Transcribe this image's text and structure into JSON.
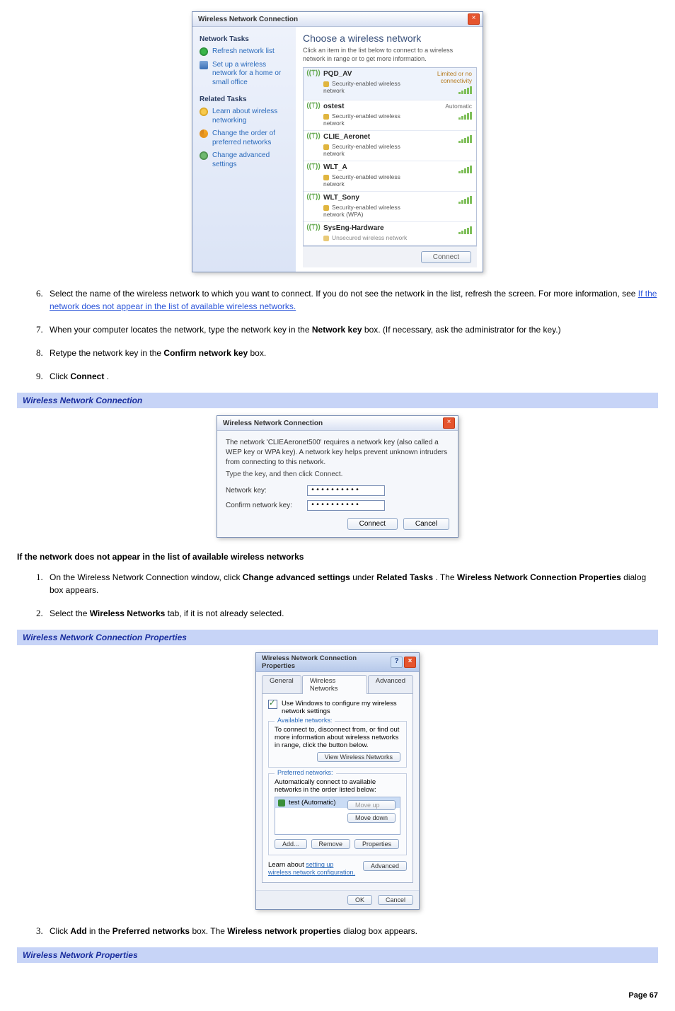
{
  "figure1": {
    "window_title": "Wireless Network Connection",
    "close_icon": "×",
    "sidebar": {
      "tasks_header": "Network Tasks",
      "refresh": "Refresh network list",
      "setup": "Set up a wireless network for a home or small office",
      "related_header": "Related Tasks",
      "learn": "Learn about wireless networking",
      "order": "Change the order of preferred networks",
      "adv": "Change advanced settings"
    },
    "main": {
      "heading": "Choose a wireless network",
      "subtext": "Click an item in the list below to connect to a wireless network in range or to get more information.",
      "signal_glyph": "((⍡))",
      "networks": [
        {
          "name": "PQD_AV",
          "desc": "Security-enabled wireless network",
          "status": "Limited or no connectivity",
          "status_kind": "warn"
        },
        {
          "name": "ostest",
          "desc": "Security-enabled wireless network",
          "status": "Automatic",
          "status_kind": "auto"
        },
        {
          "name": "CLIE_Aeronet",
          "desc": "Security-enabled wireless network",
          "status": "",
          "status_kind": ""
        },
        {
          "name": "WLT_A",
          "desc": "Security-enabled wireless network",
          "status": "",
          "status_kind": ""
        },
        {
          "name": "WLT_Sony",
          "desc": "Security-enabled wireless network (WPA)",
          "status": "",
          "status_kind": ""
        },
        {
          "name": "SysEng-Hardware",
          "desc": "Unsecured wireless network",
          "status": "",
          "status_kind": ""
        }
      ],
      "connect_btn": "Connect"
    }
  },
  "step6": {
    "text_a": "Select the name of the wireless network to which you want to connect. If you do not see the network in the list, refresh the screen. For more information, see ",
    "link": "If the network does not appear in the list of available wireless networks."
  },
  "step7": {
    "text_a": "When your computer locates the network, type the network key in the ",
    "bold_a": "Network key",
    "text_b": " box. (If necessary, ask the administrator for the key.)"
  },
  "step8": {
    "text_a": "Retype the network key in the ",
    "bold_a": "Confirm network key",
    "text_b": " box."
  },
  "step9": {
    "text_a": "Click ",
    "bold_a": "Connect",
    "text_b": "."
  },
  "bar1": "Wireless Network Connection",
  "figure2": {
    "window_title": "Wireless Network Connection",
    "msg": "The network 'CLIEAeronet500' requires a network key (also called a WEP key or WPA key). A network key helps prevent unknown intruders from connecting to this network.",
    "hint": "Type the key, and then click Connect.",
    "label_key": "Network key:",
    "label_confirm": "Confirm network key:",
    "pw_display": "••••••••••",
    "btn_connect": "Connect",
    "btn_cancel": "Cancel",
    "close_icon": "×"
  },
  "subheading": "If the network does not appear in the list of available wireless networks",
  "step_b1": {
    "text_a": "On the Wireless Network Connection window, click ",
    "bold_a": "Change advanced settings",
    "text_b": " under ",
    "bold_b": "Related Tasks",
    "text_c": ". The ",
    "bold_c": "Wireless Network Connection Properties",
    "text_d": " dialog box appears."
  },
  "step_b2": {
    "text_a": "Select the ",
    "bold_a": "Wireless Networks",
    "text_b": " tab, if it is not already selected."
  },
  "bar2": "Wireless Network Connection Properties",
  "figure3": {
    "window_title": "Wireless Network Connection Properties",
    "help_icon": "?",
    "close_icon": "×",
    "tab_general": "General",
    "tab_wireless": "Wireless Networks",
    "tab_advanced": "Advanced",
    "chk_use": "Use Windows to configure my wireless network settings",
    "grp_available_title": "Available networks:",
    "grp_available_text": "To connect to, disconnect from, or find out more information about wireless networks in range, click the button below.",
    "btn_view": "View Wireless Networks",
    "grp_pref_title": "Preferred networks:",
    "grp_pref_text": "Automatically connect to available networks in the order listed below:",
    "pref_item": "test (Automatic)",
    "btn_moveup": "Move up",
    "btn_movedown": "Move down",
    "btn_add": "Add...",
    "btn_remove": "Remove",
    "btn_props": "Properties",
    "learn_prefix": "Learn about ",
    "learn_link": "setting up wireless network configuration.",
    "btn_adv": "Advanced",
    "btn_ok": "OK",
    "btn_cancel": "Cancel"
  },
  "step_b3": {
    "text_a": "Click ",
    "bold_a": "Add",
    "text_b": " in the ",
    "bold_b": "Preferred networks",
    "text_c": " box. The ",
    "bold_c": "Wireless network properties",
    "text_d": " dialog box appears."
  },
  "bar3": "Wireless Network Properties",
  "page_number": "Page 67"
}
